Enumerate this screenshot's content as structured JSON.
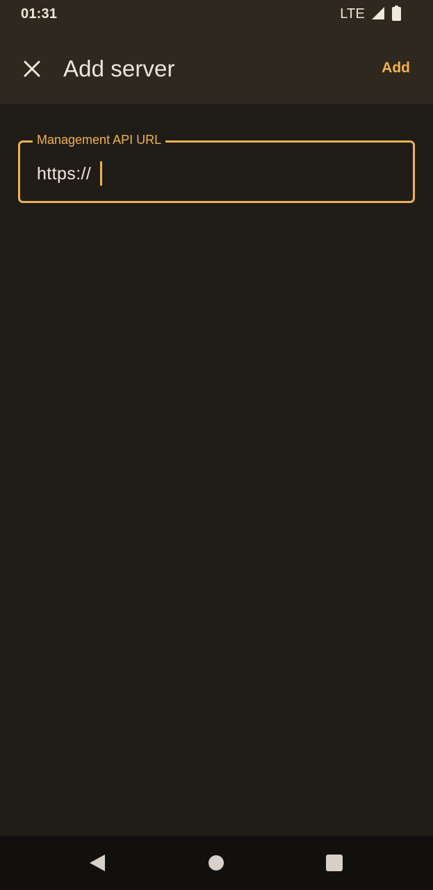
{
  "status_bar": {
    "time": "01:31",
    "network": "LTE",
    "signal_icon": "cellular-signal-icon",
    "battery_icon": "battery-full-icon"
  },
  "app_bar": {
    "title": "Add server",
    "close_icon": "close-icon",
    "add_label": "Add"
  },
  "form": {
    "url_field": {
      "label": "Management API URL",
      "value": "https://"
    }
  },
  "navigation": {
    "back_icon": "back-icon",
    "home_icon": "home-icon",
    "recents_icon": "recents-icon"
  },
  "colors": {
    "background": "#201d19",
    "top_bar": "#2f281f",
    "accent": "#f0b24e",
    "primary_text": "#f1e7dc",
    "navigation_bar": "#12100e"
  }
}
